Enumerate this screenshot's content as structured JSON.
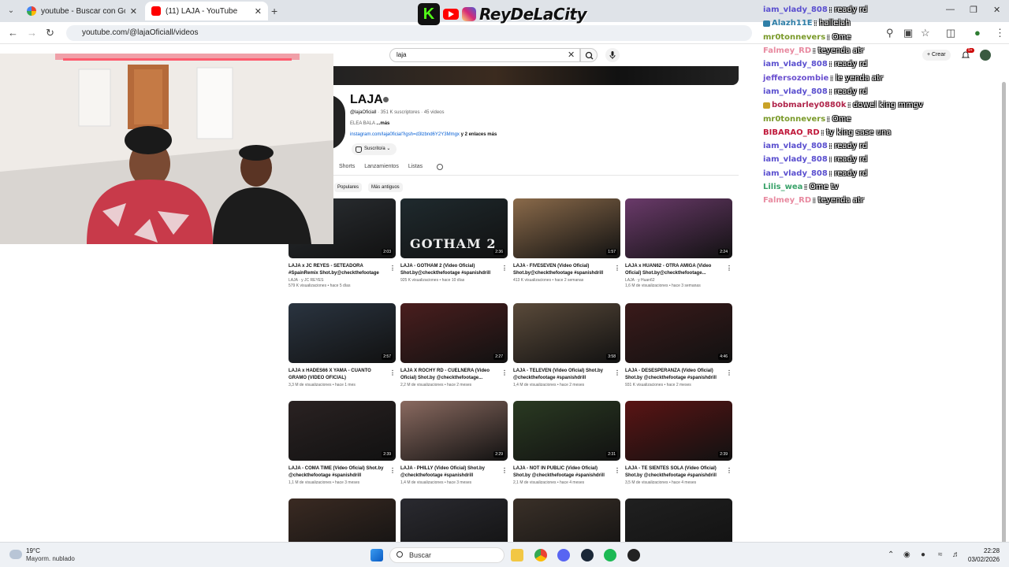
{
  "browser": {
    "tabs": [
      {
        "title": "youtube - Buscar con Google",
        "active": false
      },
      {
        "title": "(11) LAJA - YouTube",
        "active": true
      }
    ],
    "new_tab": "+",
    "url": "youtube.com/@lajaOficiall/videos"
  },
  "overlay": {
    "brand": "ReyDeLaCity",
    "kick_letter": "K"
  },
  "youtube": {
    "search_value": "laja",
    "create_label": "Crear",
    "notifications": "9+",
    "channel": {
      "name": "LAJA",
      "handle": "@lajaOficiall",
      "subscribers": "351 K suscriptores",
      "video_count": "45 videos",
      "description": "ELEA BALA",
      "more": "...más",
      "link": "instagram.com/laja0ficial?igsh=d3lzbnd6Y2Y3Mmgx",
      "extra_links": "y 2 enlaces más",
      "subscribed_label": "Suscrito/a"
    },
    "tabs": [
      "Shorts",
      "Lanzamientos",
      "Listas"
    ],
    "chips": [
      "Populares",
      "Más antiguos"
    ],
    "videos": [
      {
        "title": "LAJA x JC REYES - SETEADORA #SpainRemix Shot.by@checkthefootage",
        "channel": "LAJA · y JC REYES",
        "meta": "579 K visualizaciones • hace 5 días",
        "duration": "2:03",
        "color": "#2b2f33"
      },
      {
        "title": "LAJA - GOTHAM 2 (Video Oficial) Shot.by@checkthefootage #spanishdrill",
        "channel": "",
        "meta": "925 K visualizaciones • hace 10 días",
        "duration": "2:36",
        "color": "#1f2a2e"
      },
      {
        "title": "LAJA - FIVESEVEN (Video Oficial) Shot.by@checkthefootage #spanishdrill",
        "channel": "",
        "meta": "413 K visualizaciones • hace 2 semanas",
        "duration": "1:57",
        "color": "#8a6a4a"
      },
      {
        "title": "LAJA x HUAN62 - OTRA AMIGA (Video Oficial) Shot.by@checkthefootage...",
        "channel": "LAJA · y Huan62",
        "meta": "1,6 M de visualizaciones • hace 3 semanas",
        "duration": "2:24",
        "color": "#6a3a6a"
      },
      {
        "title": "LAJA x HADES66 X YAMA - CUANTO GRAMO (VIDEO OFICIAL)",
        "channel": "",
        "meta": "3,3 M de visualizaciones • hace 1 mes",
        "duration": "2:57",
        "color": "#2a3440"
      },
      {
        "title": "LAJA X ROCHY RD - CUELNERA (Video Oficial) Shot.by @checkthefootage...",
        "channel": "",
        "meta": "2,2 M de visualizaciones • hace 2 meses",
        "duration": "2:27",
        "color": "#4a1e1e"
      },
      {
        "title": "LAJA - TELEVEN (Video Oficial) Shot.by @checkthefootage #spanishdrill",
        "channel": "",
        "meta": "1,4 M de visualizaciones • hace 2 meses",
        "duration": "3:58",
        "color": "#5a4a3a"
      },
      {
        "title": "LAJA - DESESPERANZA (Video Oficial) Shot.by @checkthefootage #spanishdrill",
        "channel": "",
        "meta": "931 K visualizaciones • hace 2 meses",
        "duration": "4:46",
        "color": "#3a1a1a"
      },
      {
        "title": "LAJA - COMA TIME (Video Oficial) Shot.by @checkthefootage #spanishdrill",
        "channel": "",
        "meta": "1,1 M de visualizaciones • hace 3 meses",
        "duration": "2:39",
        "color": "#2a2222"
      },
      {
        "title": "LAJA - PHILLY (Video Oficial) Shot.by @checkthefootage #spanishdrill",
        "channel": "",
        "meta": "1,4 M de visualizaciones • hace 3 meses",
        "duration": "2:29",
        "color": "#8a6a60"
      },
      {
        "title": "LAJA - NOT IN PUBLIC (Video Oficial) Shot.by @checkthefootage #spanishdrill",
        "channel": "",
        "meta": "2,1 M de visualizaciones • hace 4 meses",
        "duration": "2:31",
        "color": "#2a3a22"
      },
      {
        "title": "LAJA - TE SIENTES SOLA (Video Oficial) Shot.by @checkthefootage #spanishdrill",
        "channel": "",
        "meta": "3,5 M de visualizaciones • hace 4 meses",
        "duration": "2:39",
        "color": "#5a1414"
      },
      {
        "title": "",
        "channel": "",
        "meta": "",
        "duration": "",
        "color": "#3a2a22"
      },
      {
        "title": "",
        "channel": "",
        "meta": "",
        "duration": "",
        "color": "#2a2a30"
      },
      {
        "title": "",
        "channel": "",
        "meta": "",
        "duration": "",
        "color": "#3a3028"
      },
      {
        "title": "",
        "channel": "",
        "meta": "",
        "duration": "",
        "color": "#202020"
      }
    ],
    "gotham_text": "GOTHAM 2"
  },
  "chat": [
    {
      "user": "iam_vlady_808",
      "msg": ": ready rd",
      "color": "#5a4fcf",
      "badge": ""
    },
    {
      "user": "Alazh11E",
      "msg": ": hallelah",
      "color": "#2f7fa8",
      "badge": "#2f7fa8"
    },
    {
      "user": "mr0tonnevers",
      "msg": ": Ome",
      "color": "#7a9a2a",
      "badge": ""
    },
    {
      "user": "Falmey_RD",
      "msg": ": teyenda atr",
      "color": "#e88aa0",
      "badge": ""
    },
    {
      "user": "iam_vlady_808",
      "msg": ": ready rd",
      "color": "#5a4fcf",
      "badge": ""
    },
    {
      "user": "jeffersozombie",
      "msg": ": le yenda atr",
      "color": "#6a4fcf",
      "badge": ""
    },
    {
      "user": "iam_vlady_808",
      "msg": ": ready rd",
      "color": "#5a4fcf",
      "badge": ""
    },
    {
      "user": "bobmarley0880k",
      "msg": ": dowel king mmgv",
      "color": "#b0244a",
      "badge": "#c9a227"
    },
    {
      "user": "mr0tonnevers",
      "msg": ": Ome",
      "color": "#7a9a2a",
      "badge": ""
    },
    {
      "user": "BIBARAO_RD",
      "msg": ": ty king sase una",
      "color": "#c0183a",
      "badge": ""
    },
    {
      "user": "iam_vlady_808",
      "msg": ": ready rd",
      "color": "#5a4fcf",
      "badge": ""
    },
    {
      "user": "iam_vlady_808",
      "msg": ": ready rd",
      "color": "#5a4fcf",
      "badge": ""
    },
    {
      "user": "iam_vlady_808",
      "msg": ": ready rd",
      "color": "#5a4fcf",
      "badge": ""
    },
    {
      "user": "Lilis_wea",
      "msg": ": Ome tv",
      "color": "#3aa36a",
      "badge": ""
    },
    {
      "user": "Falmey_RD",
      "msg": ": teyenda atr",
      "color": "#e88aa0",
      "badge": ""
    }
  ],
  "taskbar": {
    "temp": "19°C",
    "weather": "Mayorm. nublado",
    "search": "Buscar",
    "time": "22:28",
    "date": "03/02/2026"
  }
}
